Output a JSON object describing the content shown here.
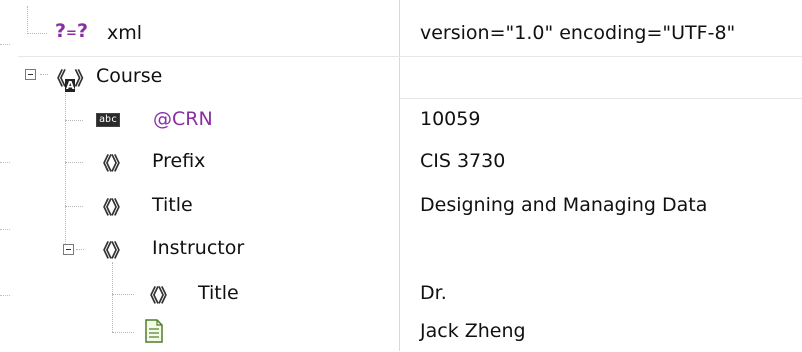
{
  "rows": [
    {
      "name": "xml",
      "value": "version=\"1.0\" encoding=\"UTF-8\"",
      "icon": "processing-instruction-icon",
      "icon_text": "?=?"
    },
    {
      "name": "Course",
      "value": "",
      "icon": "element-icon",
      "icon_text": "《A》"
    },
    {
      "name": "@CRN",
      "value": "10059",
      "icon": "attribute-icon",
      "icon_text": "abc"
    },
    {
      "name": "Prefix",
      "value": "CIS 3730",
      "icon": "element-icon",
      "icon_text": "《》"
    },
    {
      "name": "Title",
      "value": "Designing and Managing Data",
      "icon": "element-icon",
      "icon_text": "《》"
    },
    {
      "name": "Instructor",
      "value": "",
      "icon": "element-icon",
      "icon_text": "《》"
    },
    {
      "name": "Title",
      "value": "Dr.",
      "icon": "element-icon",
      "icon_text": "《》"
    },
    {
      "name": "",
      "value": "Jack Zheng",
      "icon": "text-node-icon",
      "icon_text": ""
    }
  ],
  "colors": {
    "attribute": "#8a2fa3",
    "grid": "#d8d8d8"
  }
}
